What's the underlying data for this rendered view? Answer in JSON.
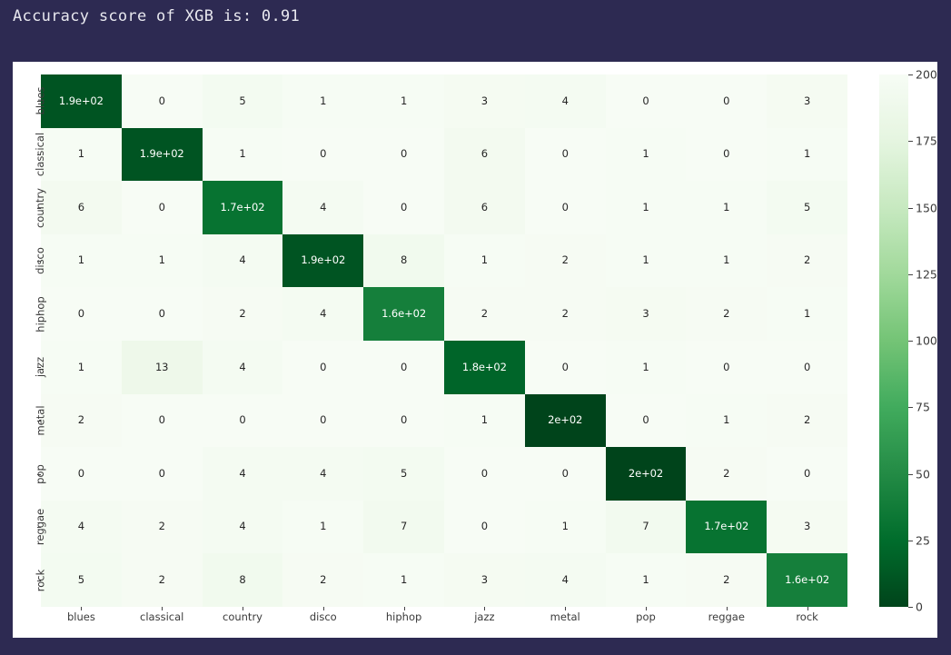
{
  "title": "Accuracy score of XGB is: 0.91",
  "chart_data": {
    "type": "heatmap",
    "title": "Accuracy score of XGB is: 0.91",
    "xlabel": "",
    "ylabel": "",
    "categories": [
      "blues",
      "classical",
      "country",
      "disco",
      "hiphop",
      "jazz",
      "metal",
      "pop",
      "reggae",
      "rock"
    ],
    "x_tick_labels": [
      "blues",
      "classical",
      "country",
      "disco",
      "hiphop",
      "jazz",
      "metal",
      "pop",
      "reggae",
      "rock"
    ],
    "y_tick_labels": [
      "blues",
      "classical",
      "country",
      "disco",
      "hiphop",
      "jazz",
      "metal",
      "pop",
      "reggae",
      "rock"
    ],
    "colorbar": {
      "ticks": [
        0,
        25,
        50,
        75,
        100,
        125,
        150,
        175,
        200
      ],
      "tick_labels": [
        "0",
        "25",
        "50",
        "75",
        "100",
        "125",
        "150",
        "175",
        "200"
      ],
      "vmin": 0,
      "vmax": 200,
      "colormap": "Greens",
      "position": "right"
    },
    "grid": false,
    "annotations_format": "2 significant digits",
    "values": [
      [
        190,
        0,
        5,
        1,
        1,
        3,
        4,
        0,
        0,
        3
      ],
      [
        1,
        190,
        1,
        0,
        0,
        6,
        0,
        1,
        0,
        1
      ],
      [
        6,
        0,
        170,
        4,
        0,
        6,
        0,
        1,
        1,
        5
      ],
      [
        1,
        1,
        4,
        190,
        8,
        1,
        2,
        1,
        1,
        2
      ],
      [
        0,
        0,
        2,
        4,
        160,
        2,
        2,
        3,
        2,
        1
      ],
      [
        1,
        13,
        4,
        0,
        0,
        180,
        0,
        1,
        0,
        0
      ],
      [
        2,
        0,
        0,
        0,
        0,
        1,
        200,
        0,
        1,
        2
      ],
      [
        0,
        0,
        4,
        4,
        5,
        0,
        0,
        200,
        2,
        0
      ],
      [
        4,
        2,
        4,
        1,
        7,
        0,
        1,
        7,
        170,
        3
      ],
      [
        5,
        2,
        8,
        2,
        1,
        3,
        4,
        1,
        2,
        160
      ]
    ],
    "cell_labels": [
      [
        "1.9e+02",
        "0",
        "5",
        "1",
        "1",
        "3",
        "4",
        "0",
        "0",
        "3"
      ],
      [
        "1",
        "1.9e+02",
        "1",
        "0",
        "0",
        "6",
        "0",
        "1",
        "0",
        "1"
      ],
      [
        "6",
        "0",
        "1.7e+02",
        "4",
        "0",
        "6",
        "0",
        "1",
        "1",
        "5"
      ],
      [
        "1",
        "1",
        "4",
        "1.9e+02",
        "8",
        "1",
        "2",
        "1",
        "1",
        "2"
      ],
      [
        "0",
        "0",
        "2",
        "4",
        "1.6e+02",
        "2",
        "2",
        "3",
        "2",
        "1"
      ],
      [
        "1",
        "13",
        "4",
        "0",
        "0",
        "1.8e+02",
        "0",
        "1",
        "0",
        "0"
      ],
      [
        "2",
        "0",
        "0",
        "0",
        "0",
        "1",
        "2e+02",
        "0",
        "1",
        "2"
      ],
      [
        "0",
        "0",
        "4",
        "4",
        "5",
        "0",
        "0",
        "2e+02",
        "2",
        "0"
      ],
      [
        "4",
        "2",
        "4",
        "1",
        "7",
        "0",
        "1",
        "7",
        "1.7e+02",
        "3"
      ],
      [
        "5",
        "2",
        "8",
        "2",
        "1",
        "3",
        "4",
        "1",
        "2",
        "1.6e+02"
      ]
    ]
  },
  "colors": {
    "background": "#2d2a52",
    "figure": "#ffffff",
    "title_text": "#e8e8ef",
    "tick_text": "#3a3a3a",
    "cmap_low": "#f7fcf5",
    "cmap_high": "#00441b"
  }
}
